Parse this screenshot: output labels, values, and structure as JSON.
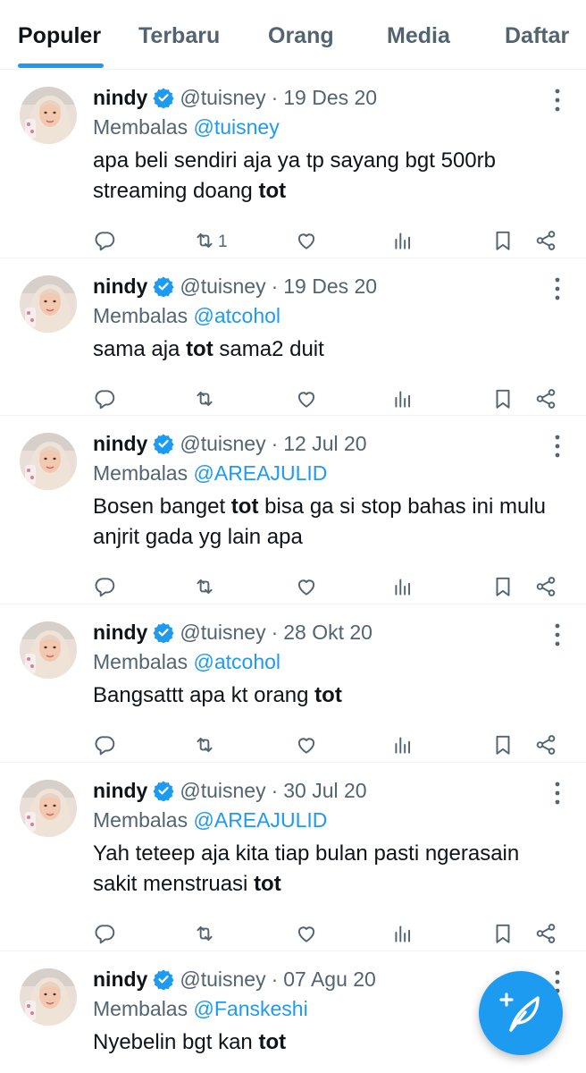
{
  "tabs": [
    {
      "label": "Populer",
      "active": true
    },
    {
      "label": "Terbaru",
      "active": false
    },
    {
      "label": "Orang",
      "active": false
    },
    {
      "label": "Media",
      "active": false
    },
    {
      "label": "Daftar",
      "active": false
    }
  ],
  "accent_color": "#1d9bf0",
  "tweets": [
    {
      "name": "nindy",
      "handle": "@tuisney",
      "separator": "·",
      "date": "19 Des 20",
      "reply_prefix": "Membalas",
      "reply_to": "@tuisney",
      "text_before": "apa beli sendiri aja ya tp sayang bgt 500rb streaming doang ",
      "keyword": "tot",
      "text_after": "",
      "retweets": "1"
    },
    {
      "name": "nindy",
      "handle": "@tuisney",
      "separator": "·",
      "date": "19 Des 20",
      "reply_prefix": "Membalas",
      "reply_to": "@atcohol",
      "text_before": "sama aja ",
      "keyword": "tot",
      "text_after": " sama2 duit",
      "retweets": ""
    },
    {
      "name": "nindy",
      "handle": "@tuisney",
      "separator": "·",
      "date": "12 Jul 20",
      "reply_prefix": "Membalas",
      "reply_to": "@AREAJULID",
      "text_before": "Bosen banget ",
      "keyword": "tot",
      "text_after": " bisa ga si stop bahas ini mulu anjrit gada yg lain apa",
      "retweets": ""
    },
    {
      "name": "nindy",
      "handle": "@tuisney",
      "separator": "·",
      "date": "28 Okt 20",
      "reply_prefix": "Membalas",
      "reply_to": "@atcohol",
      "text_before": "Bangsattt apa kt orang ",
      "keyword": "tot",
      "text_after": "",
      "retweets": ""
    },
    {
      "name": "nindy",
      "handle": "@tuisney",
      "separator": "·",
      "date": "30 Jul 20",
      "reply_prefix": "Membalas",
      "reply_to": "@AREAJULID",
      "text_before": "Yah teteep aja kita tiap bulan pasti ngerasain sakit menstruasi ",
      "keyword": "tot",
      "text_after": "",
      "retweets": ""
    },
    {
      "name": "nindy",
      "handle": "@tuisney",
      "separator": "·",
      "date": "07 Agu 20",
      "reply_prefix": "Membalas",
      "reply_to": "@Fanskeshi",
      "text_before": "Nyebelin bgt kan ",
      "keyword": "tot",
      "text_after": "",
      "retweets": ""
    }
  ],
  "icons": {
    "reply": "reply-icon",
    "retweet": "retweet-icon",
    "like": "heart-icon",
    "views": "views-chart-icon",
    "bookmark": "bookmark-icon",
    "share": "share-icon",
    "verified": "verified-badge-icon",
    "more": "more-vertical-icon",
    "compose": "compose-tweet-icon"
  }
}
